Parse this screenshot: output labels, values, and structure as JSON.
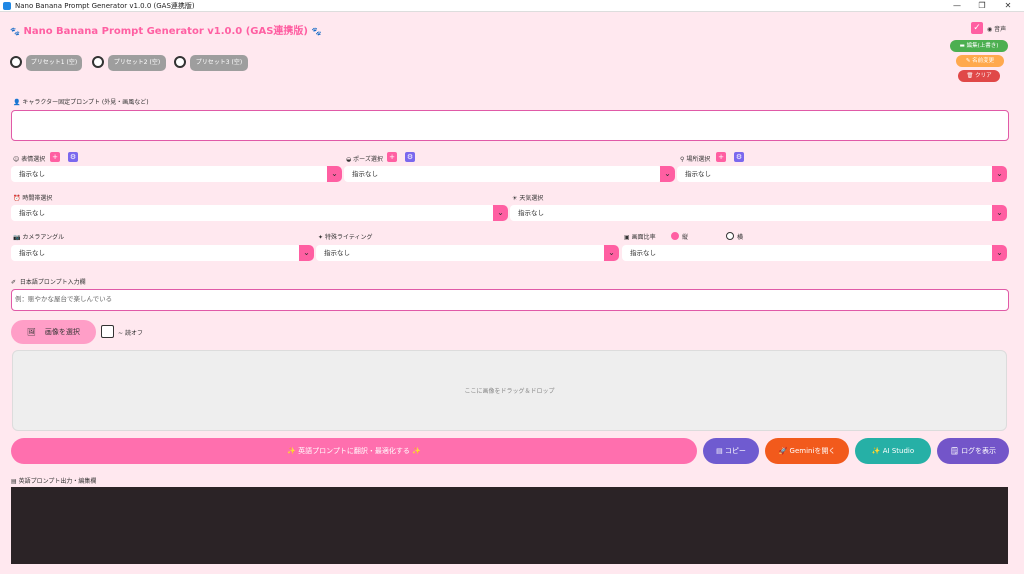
{
  "window": {
    "title": "Nano Banana Prompt Generator v1.0.0 (GAS連携版)",
    "minimize": "—",
    "maximize": "❐",
    "close": "✕"
  },
  "header": {
    "title": "Nano Banana Prompt Generator v1.0.0 (GAS連携版)",
    "paw_left": "🐾",
    "paw_right": "🐾",
    "voice_label": "音声",
    "voice_checked": "✓",
    "edit_button": "編集(上書き)",
    "rename_button": "名前変更",
    "clear_button": "クリア",
    "colors": {
      "accent": "#ff5fa2",
      "green": "#4caf50",
      "orange": "#ffa94d",
      "red": "#e04848"
    }
  },
  "presets": [
    {
      "label": "プリセット1 (空)"
    },
    {
      "label": "プリセット2 (空)"
    },
    {
      "label": "プリセット3 (空)"
    }
  ],
  "character": {
    "label": "キャラクター固定プロンプト (外見・画風など)",
    "icon": "person-icon"
  },
  "selects": {
    "expression": {
      "label": "表情選択",
      "value": "指示なし"
    },
    "pose": {
      "label": "ポーズ選択",
      "value": "指示なし"
    },
    "place": {
      "label": "場所選択",
      "value": "指示なし"
    },
    "time": {
      "label": "時間帯選択",
      "value": "指示なし"
    },
    "weather": {
      "label": "天気選択",
      "value": "指示なし"
    },
    "camera": {
      "label": "カメラアングル",
      "value": "指示なし"
    },
    "lighting": {
      "label": "特殊ライティング",
      "value": "指示なし"
    },
    "ratio": {
      "label": "画面比率",
      "value": "指示なし",
      "option_vertical": "縦",
      "option_horizontal": "横"
    }
  },
  "jp_prompt": {
    "label": "日本語プロンプト入力欄",
    "placeholder": "例：賑やかな屋台で楽しんでいる"
  },
  "image": {
    "select_button": "画像を選択",
    "toggle_label": "読オフ",
    "dropzone_text": "ここに画像をドラッグ＆ドロップ"
  },
  "actions": {
    "translate": "英語プロンプトに翻訳・最適化する",
    "copy": "コピー",
    "gemini": "Geminiを開く",
    "ai_studio": "AI Studio",
    "log": "ログを表示",
    "colors": {
      "translate": "#ff6fae",
      "copy": "#6f5bd0",
      "gemini": "#f25a1c",
      "ai_studio": "#26b0a6",
      "log": "#7355c9"
    }
  },
  "output": {
    "label": "英語プロンプト出力・編集欄"
  }
}
